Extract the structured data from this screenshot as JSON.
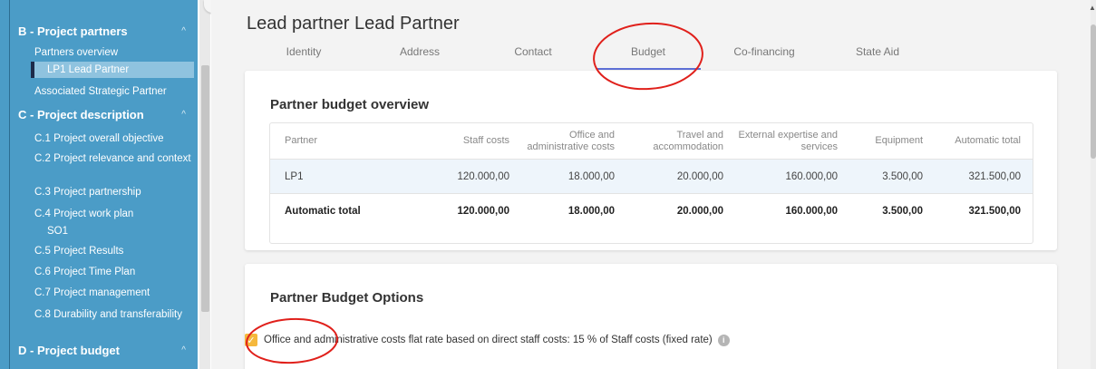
{
  "sidebar": {
    "sections": [
      {
        "label": "B - Project partners",
        "chevron": "^"
      },
      {
        "label": "C - Project description",
        "chevron": "^"
      },
      {
        "label": "D - Project budget",
        "chevron": "^"
      }
    ],
    "items": [
      {
        "label": "Partners overview"
      },
      {
        "label": "LP1 Lead Partner"
      },
      {
        "label": "Associated Strategic Partner"
      },
      {
        "label": "C.1 Project overall objective"
      },
      {
        "label": "C.2 Project relevance and context"
      },
      {
        "label": "C.3 Project partnership"
      },
      {
        "label": "C.4 Project work plan"
      },
      {
        "label": "SO1"
      },
      {
        "label": "C.5 Project Results"
      },
      {
        "label": "C.6 Project Time Plan"
      },
      {
        "label": "C.7 Project management"
      },
      {
        "label": "C.8 Durability and transferability"
      }
    ]
  },
  "page": {
    "title": "Lead partner Lead Partner",
    "tabs": [
      {
        "label": "Identity"
      },
      {
        "label": "Address"
      },
      {
        "label": "Contact"
      },
      {
        "label": "Budget"
      },
      {
        "label": "Co-financing"
      },
      {
        "label": "State Aid"
      }
    ],
    "active_tab": "Budget"
  },
  "budget_overview": {
    "title": "Partner budget overview",
    "columns": [
      "Partner",
      "Staff costs",
      "Office and administrative costs",
      "Travel and accommodation",
      "External expertise and services",
      "Equipment",
      "Automatic total"
    ],
    "rows": [
      [
        "LP1",
        "120.000,00",
        "18.000,00",
        "20.000,00",
        "160.000,00",
        "3.500,00",
        "321.500,00"
      ],
      [
        "Automatic total",
        "120.000,00",
        "18.000,00",
        "20.000,00",
        "160.000,00",
        "3.500,00",
        "321.500,00"
      ]
    ]
  },
  "budget_options": {
    "title": "Partner Budget Options",
    "option_label": "Office and administrative costs flat rate based on direct staff costs: 15 % of Staff costs (fixed rate)",
    "checked": true,
    "info_icon": "info-icon"
  },
  "colors": {
    "sidebar_bg": "#4b9cc7",
    "accent_tab": "#5d6fd6",
    "checkbox": "#f5b83d",
    "annotation_circle": "#e0201b"
  }
}
